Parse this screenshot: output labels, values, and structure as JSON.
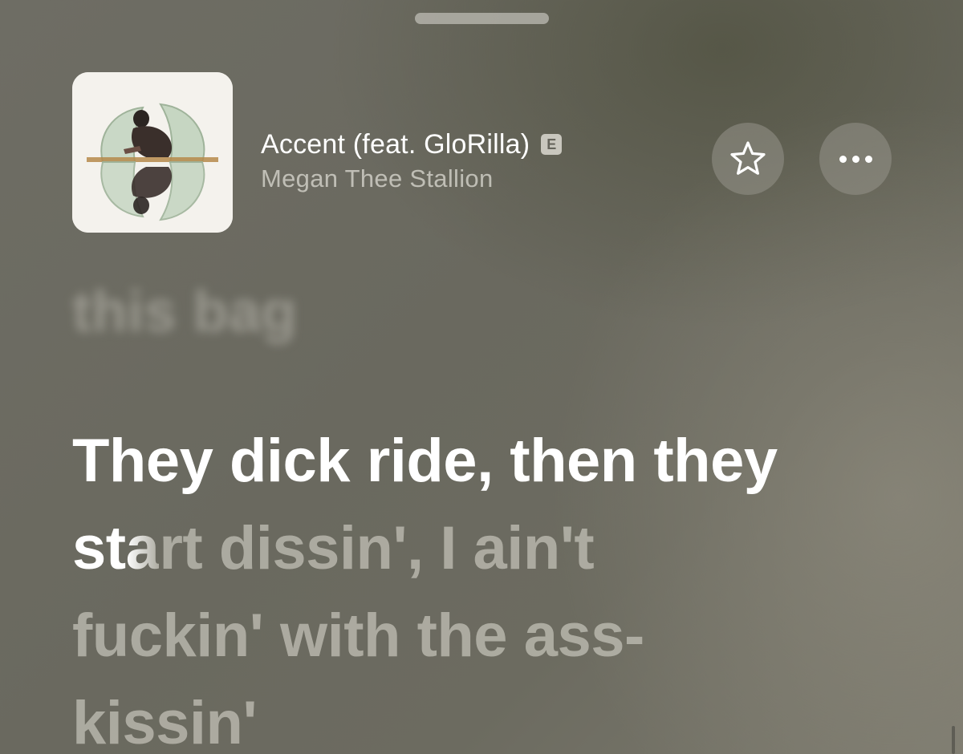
{
  "now_playing": {
    "title": "Accent (feat. GloRilla)",
    "explicit_badge": "E",
    "artist": "Megan Thee Stallion"
  },
  "actions": {
    "favorite_icon": "star-outline-icon",
    "more_icon": "ellipsis-icon"
  },
  "lyrics": {
    "previous_line": "this bag",
    "current_line": {
      "sung": "They dick ride, then they st",
      "fading": "a",
      "unsung": "rt dissin', I ain't fuckin' with the ass-kissin'"
    }
  },
  "colors": {
    "background": "#6c6b61",
    "text_active": "#ffffff",
    "text_inactive": "#c8c6bc"
  }
}
